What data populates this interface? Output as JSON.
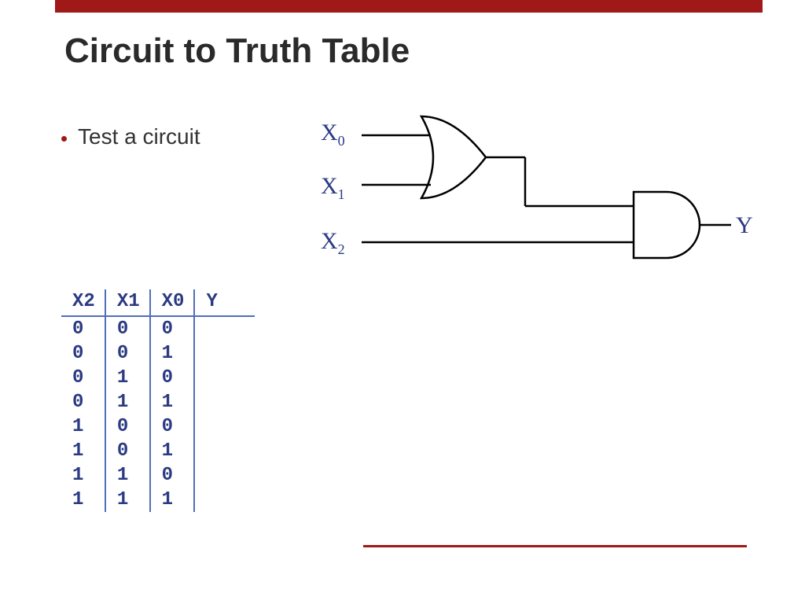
{
  "colors": {
    "accent": "#a01818",
    "diagram_text": "#2b3a82",
    "table_border": "#516fb6"
  },
  "title": "Circuit to Truth Table",
  "bullet": "Test a circuit",
  "circuit": {
    "inputs": [
      "X0",
      "X1",
      "X2"
    ],
    "output": "Y",
    "gates": [
      {
        "type": "OR",
        "inputs": [
          "X0",
          "X1"
        ],
        "output": "G1"
      },
      {
        "type": "AND",
        "inputs": [
          "G1",
          "X2"
        ],
        "output": "Y"
      }
    ],
    "labels": {
      "x0_base": "X",
      "x0_sub": "0",
      "x1_base": "X",
      "x1_sub": "1",
      "x2_base": "X",
      "x2_sub": "2",
      "y": "Y"
    }
  },
  "truth_table": {
    "headers": [
      "X2",
      "X1",
      "X0",
      "Y"
    ],
    "rows": [
      [
        "0",
        "0",
        "0",
        ""
      ],
      [
        "0",
        "0",
        "1",
        ""
      ],
      [
        "0",
        "1",
        "0",
        ""
      ],
      [
        "0",
        "1",
        "1",
        ""
      ],
      [
        "1",
        "0",
        "0",
        ""
      ],
      [
        "1",
        "0",
        "1",
        ""
      ],
      [
        "1",
        "1",
        "0",
        ""
      ],
      [
        "1",
        "1",
        "1",
        ""
      ]
    ]
  }
}
